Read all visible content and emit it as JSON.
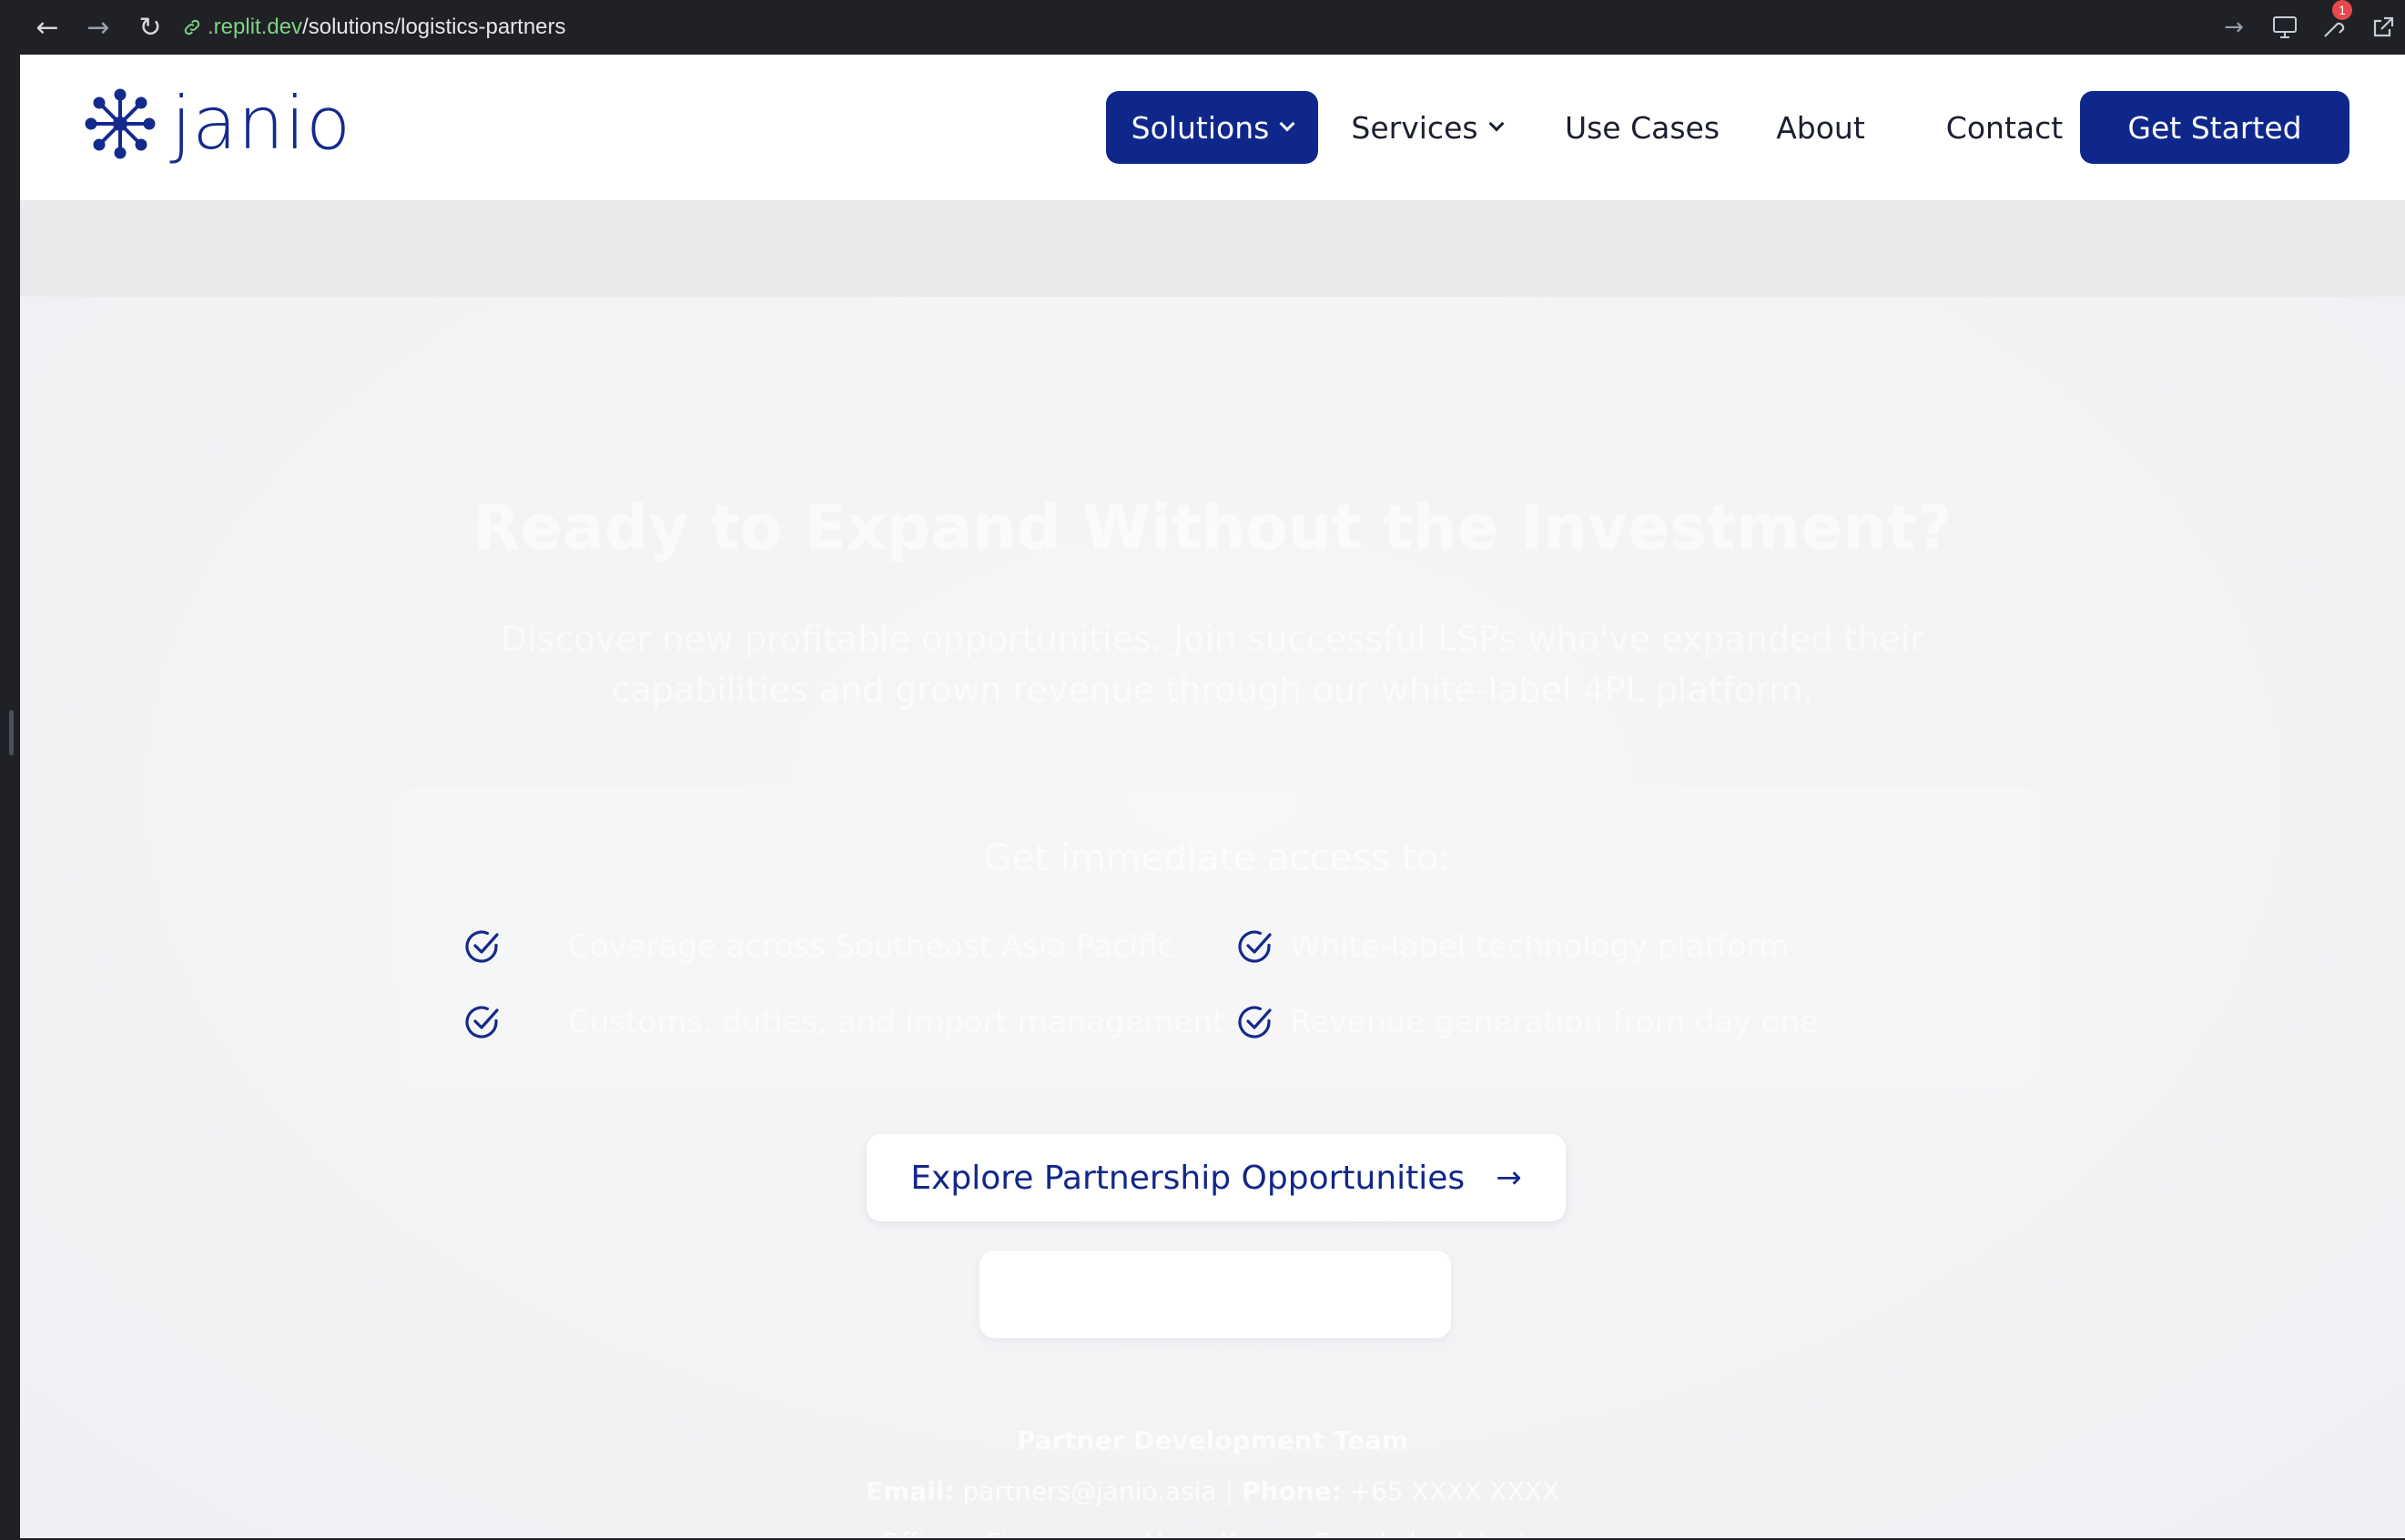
{
  "browser": {
    "url_host": ".replit.dev",
    "url_path": "/solutions/logistics-partners",
    "notification_count": "1"
  },
  "brand": {
    "name": "janio",
    "color": "#0f278a"
  },
  "nav": {
    "solutions": "Solutions",
    "services": "Services",
    "use_cases": "Use Cases",
    "about": "About",
    "contact": "Contact",
    "get_started": "Get Started"
  },
  "cta": {
    "title": "Ready to Expand Without the Investment?",
    "subtitle": "Discover new profitable opportunities. Join successful LSPs who've expanded their capabilities and grown revenue through our white-label 4PL platform.",
    "access_title": "Get immediate access to:",
    "features": [
      "Coverage across Southeast Asia Pacific",
      "White-label technology platform",
      "Customs, duties, and import management",
      "Revenue generation from day one"
    ],
    "explore_button": "Explore Partnership Opportunities",
    "contact": {
      "team": "Partner Development Team",
      "email_label": "Email:",
      "email": "partners@janio.asia",
      "separator": "|",
      "phone_label": "Phone:",
      "phone": "+65 XXXX XXXX",
      "offices": "Offices: Singapore • Hong Kong • Bangkok • Jakarta"
    }
  }
}
